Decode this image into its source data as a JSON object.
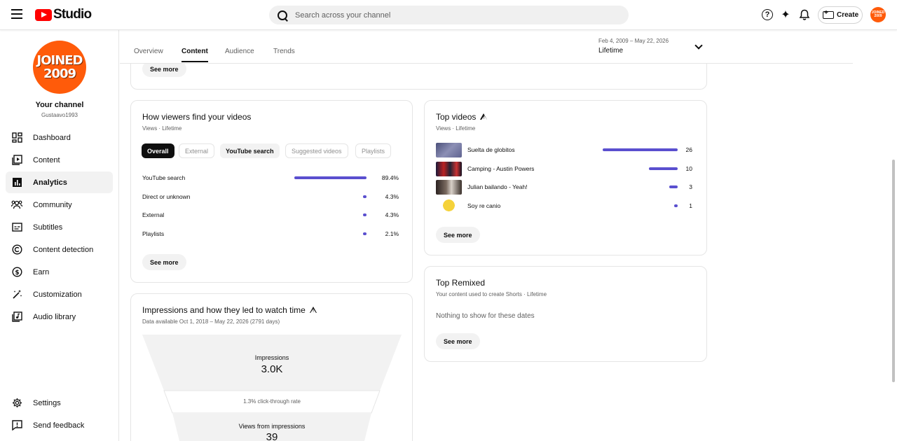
{
  "header": {
    "logo_text": "Studio",
    "search_placeholder": "Search across your channel",
    "create_label": "Create",
    "avatar_text_1": "JOINED",
    "avatar_text_2": "2009"
  },
  "sidebar": {
    "avatar_line1": "JOINED",
    "avatar_line2": "2009",
    "channel_title": "Your channel",
    "channel_handle": "Gustaavo1993",
    "items": [
      {
        "label": "Dashboard",
        "icon": "dashboard-icon"
      },
      {
        "label": "Content",
        "icon": "content-icon"
      },
      {
        "label": "Analytics",
        "icon": "analytics-icon",
        "active": true
      },
      {
        "label": "Community",
        "icon": "community-icon"
      },
      {
        "label": "Subtitles",
        "icon": "subtitles-icon"
      },
      {
        "label": "Content detection",
        "icon": "copyright-icon"
      },
      {
        "label": "Earn",
        "icon": "dollar-icon"
      },
      {
        "label": "Customization",
        "icon": "magic-wand-icon"
      },
      {
        "label": "Audio library",
        "icon": "audio-library-icon"
      }
    ],
    "settings_label": "Settings",
    "feedback_label": "Send feedback"
  },
  "tabs": [
    "Overview",
    "Content",
    "Audience",
    "Trends"
  ],
  "active_tab": "Content",
  "date_range": {
    "range": "Feb 4, 2009 – May 22, 2026",
    "label": "Lifetime"
  },
  "top_card": {
    "see_more": "See more"
  },
  "traffic_sources": {
    "title": "How viewers find your videos",
    "subtitle": "Views · Lifetime",
    "chips": [
      "Overall",
      "External",
      "YouTube search",
      "Suggested videos",
      "Playlists"
    ],
    "rows": [
      {
        "label": "YouTube search",
        "value": "89.4%",
        "fraction": 0.894
      },
      {
        "label": "Direct or unknown",
        "value": "4.3%",
        "fraction": 0.043
      },
      {
        "label": "External",
        "value": "4.3%",
        "fraction": 0.043
      },
      {
        "label": "Playlists",
        "value": "2.1%",
        "fraction": 0.021
      }
    ],
    "see_more": "See more"
  },
  "top_videos": {
    "title": "Top videos",
    "subtitle": "Views · Lifetime",
    "rows": [
      {
        "title": "Suelta de globitos",
        "views": "26",
        "fraction": 1.0
      },
      {
        "title": "Camping - Austin Powers",
        "views": "10",
        "fraction": 0.38
      },
      {
        "title": "Julian bailando - Yeah!",
        "views": "3",
        "fraction": 0.11
      },
      {
        "title": "Soy re canio",
        "views": "1",
        "fraction": 0.04
      }
    ],
    "see_more": "See more"
  },
  "top_remixed": {
    "title": "Top Remixed",
    "subtitle": "Your content used to create Shorts · Lifetime",
    "empty_text": "Nothing to show for these dates",
    "see_more": "See more"
  },
  "impressions": {
    "title": "Impressions and how they led to watch time",
    "subtitle": "Data available Oct 1, 2018 – May 22, 2026 (2791 days)",
    "impressions_label": "Impressions",
    "impressions_value": "3.0K",
    "ctr_text": "1.3% click-through rate",
    "views_label": "Views from impressions",
    "views_value": "39"
  },
  "colors": {
    "accent_bar": "#5a4fcf",
    "brand_red": "#ff0000",
    "avatar_orange": "#ff5b0a"
  }
}
